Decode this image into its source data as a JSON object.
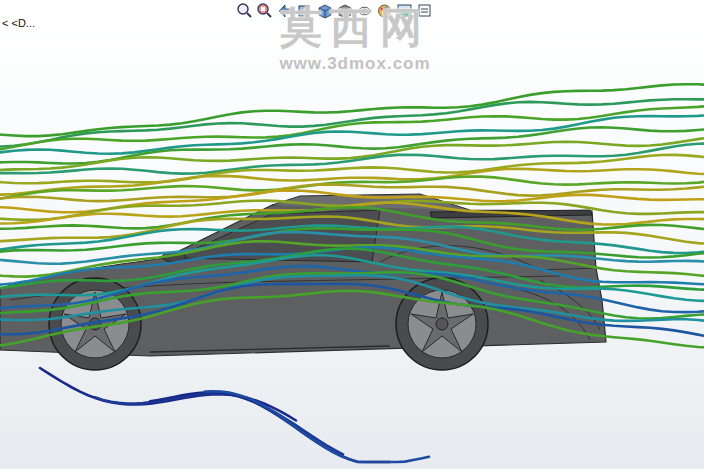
{
  "viewport": {
    "breadcrumb": "< <D..."
  },
  "watermark": {
    "name": "莫西网",
    "url": "www.3dmox.com"
  },
  "streamlines": [
    {
      "kind": "flow",
      "color": "#3a9e2c"
    },
    {
      "kind": "flow",
      "color": "#2e9a5a"
    },
    {
      "kind": "flow",
      "color": "#4aa428"
    },
    {
      "kind": "flow",
      "color": "#1f9a8a"
    },
    {
      "kind": "flow",
      "color": "#3fa030"
    },
    {
      "kind": "flow",
      "color": "#7aa822"
    },
    {
      "kind": "flow",
      "color": "#2a9c70"
    },
    {
      "kind": "flow",
      "color": "#9aa81e"
    },
    {
      "kind": "flow",
      "color": "#b0a41c"
    },
    {
      "kind": "flow",
      "color": "#5aa626"
    },
    {
      "kind": "flow",
      "color": "#aaa020"
    },
    {
      "kind": "flow",
      "color": "#c0a018"
    },
    {
      "kind": "flow",
      "color": "#8aa620"
    },
    {
      "kind": "flow",
      "color": "#b8a41a"
    },
    {
      "kind": "flow",
      "color": "#42a02a"
    },
    {
      "kind": "flow",
      "color": "#a4a41e"
    },
    {
      "kind": "flow",
      "color": "#20988e"
    },
    {
      "kind": "flow",
      "color": "#3a9e2e"
    },
    {
      "kind": "flow",
      "color": "#2a8fa8"
    },
    {
      "kind": "flow",
      "color": "#56a428"
    },
    {
      "kind": "flow",
      "color": "#1e7cae"
    },
    {
      "kind": "flow",
      "color": "#2e9e3a"
    },
    {
      "kind": "flow",
      "color": "#1e9a96"
    },
    {
      "kind": "flow",
      "color": "#1f64a8"
    },
    {
      "kind": "flow",
      "color": "#3aa030"
    },
    {
      "kind": "flow",
      "color": "#2090a0"
    },
    {
      "kind": "flow",
      "color": "#1c56a0"
    },
    {
      "kind": "flow",
      "color": "#46a22a"
    },
    {
      "kind": "ground",
      "color": "#1a2a8c"
    },
    {
      "kind": "ground",
      "color": "#1c3a96"
    },
    {
      "kind": "ground",
      "color": "#182a88"
    },
    {
      "kind": "ground",
      "color": "#1e4aa0"
    }
  ]
}
